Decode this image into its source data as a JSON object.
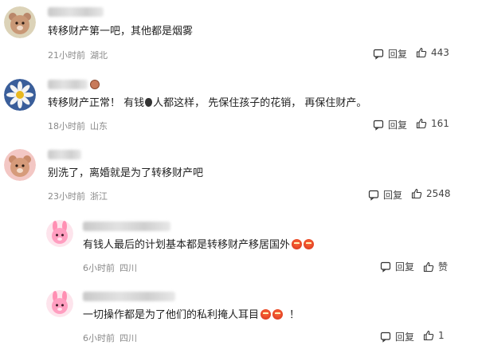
{
  "comments": [
    {
      "text": "转移财产第一吧，其他都是烟雾",
      "time": "21小时前",
      "location": "湖北",
      "reply_label": "回复",
      "likes": "443"
    },
    {
      "text_before": "转移财产正常！ 有钱",
      "text_after": "人都这样， 先保住孩子的花销， 再保住财产。",
      "time": "18小时前",
      "location": "山东",
      "reply_label": "回复",
      "likes": "161"
    },
    {
      "text": "别洗了，离婚就是为了转移财产吧",
      "time": "23小时前",
      "location": "浙江",
      "reply_label": "回复",
      "likes": "2548"
    }
  ],
  "replies": [
    {
      "text": "有钱人最后的计划基本都是转移财产移居国外",
      "time": "6小时前",
      "location": "四川",
      "reply_label": "回复",
      "likes": "赞"
    },
    {
      "text": "一切操作都是为了他们的私利掩人耳目",
      "text_tail": "！",
      "time": "6小时前",
      "location": "四川",
      "reply_label": "回复",
      "likes": "1"
    }
  ],
  "icons": {
    "reply": "comment-bubble-icon",
    "like": "thumbs-up-icon",
    "emoji": "angry-face-emoji",
    "moneybag": "money-bag-emoji"
  },
  "colors": {
    "text": "#222222",
    "meta": "#8a8a8a",
    "action": "#444444"
  }
}
